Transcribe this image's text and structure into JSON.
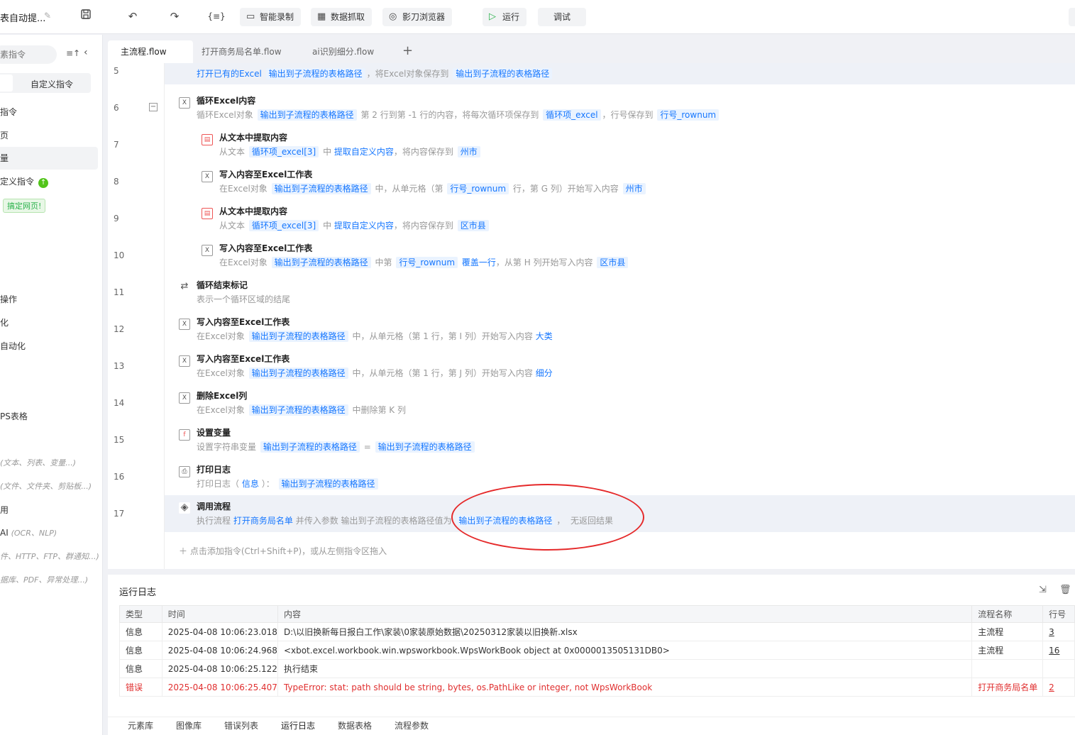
{
  "app": {
    "title": "表自动提...",
    "edit_icon": "pencil-icon"
  },
  "toolbar": {
    "save_icon": "save-icon",
    "undo_icon": "undo-icon",
    "redo_icon": "redo-icon",
    "format_label": "{≡}",
    "smart_record": "智能录制",
    "data_capture": "数据抓取",
    "browser": "影刀浏览器",
    "run": "运行",
    "debug": "调试"
  },
  "sidebar": {
    "search_placeholder": "素指令",
    "custom_tab": "自定义指令",
    "items": [
      {
        "label": "指令"
      },
      {
        "label": "页"
      },
      {
        "label": "量"
      },
      {
        "label": "定义指令"
      },
      {
        "label": "操作"
      },
      {
        "label": "化"
      },
      {
        "label": "自动化"
      },
      {
        "label": "PS表格"
      },
      {
        "label": "",
        "hint": "(文本、列表、变量...)"
      },
      {
        "label": "",
        "hint": "(文件、文件夹、剪贴板...)"
      },
      {
        "label": "用"
      },
      {
        "label": "AI",
        "hint": "(OCR、NLP)"
      },
      {
        "label": "",
        "hint": "件、HTTP、FTP、群通知...)"
      },
      {
        "label": "",
        "hint": "据库、PDF、异常处理...)"
      }
    ],
    "badge": "搞定网页!"
  },
  "tabs": [
    {
      "label": "主流程.flow"
    },
    {
      "label": "打开商务局名单.flow"
    },
    {
      "label": "ai识别细分.flow"
    }
  ],
  "flow": {
    "line_numbers": [
      "5",
      "6",
      "7",
      "8",
      "9",
      "10",
      "11",
      "12",
      "13",
      "14",
      "15",
      "16",
      "17"
    ],
    "rows": [
      {
        "desc_parts": [
          "打开已有的Excel",
          "输出到子流程的表格路径",
          "，将Excel对象保存到",
          "输出到子流程的表格路径"
        ]
      },
      {
        "title": "循环Excel内容",
        "desc": [
          "循环Excel对象",
          "输出到子流程的表格路径",
          "第 2 行到第 -1 行的内容，将每次循环项保存到",
          "循环项_excel",
          "，行号保存到",
          "行号_rownum"
        ]
      },
      {
        "title": "从文本中提取内容",
        "desc": [
          "从文本",
          "循环项_excel[3]",
          "中",
          "提取自定义内容",
          "，将内容保存到",
          "州市"
        ]
      },
      {
        "title": "写入内容至Excel工作表",
        "desc": [
          "在Excel对象",
          "输出到子流程的表格路径",
          "中，从单元格（第",
          "行号_rownum",
          "行，第 G 列）开始写入内容",
          "州市"
        ]
      },
      {
        "title": "从文本中提取内容",
        "desc": [
          "从文本",
          "循环项_excel[3]",
          "中",
          "提取自定义内容",
          "，将内容保存到",
          "区市县"
        ]
      },
      {
        "title": "写入内容至Excel工作表",
        "desc": [
          "在Excel对象",
          "输出到子流程的表格路径",
          "中第",
          "行号_rownum",
          "覆盖一行",
          "，从第 H 列开始写入内容",
          "区市县"
        ]
      },
      {
        "title": "循环结束标记",
        "desc": [
          "表示一个循环区域的结尾"
        ]
      },
      {
        "title": "写入内容至Excel工作表",
        "desc": [
          "在Excel对象",
          "输出到子流程的表格路径",
          "中，从单元格（第 1 行，第 I 列）开始写入内容",
          "大类"
        ]
      },
      {
        "title": "写入内容至Excel工作表",
        "desc": [
          "在Excel对象",
          "输出到子流程的表格路径",
          "中，从单元格（第 1 行，第 J 列）开始写入内容",
          "细分"
        ]
      },
      {
        "title": "删除Excel列",
        "desc": [
          "在Excel对象",
          "输出到子流程的表格路径",
          "中删除第 K 列"
        ]
      },
      {
        "title": "设置变量",
        "desc": [
          "设置字符串变量",
          "输出到子流程的表格路径",
          "=",
          "输出到子流程的表格路径"
        ]
      },
      {
        "title": "打印日志",
        "desc": [
          "打印日志（",
          "信息",
          "）：",
          "输出到子流程的表格路径"
        ]
      },
      {
        "title": "调用流程",
        "desc": [
          "执行流程",
          "打开商务局名单",
          "并传入参数 输出到子流程的表格路径值为",
          "输出到子流程的表格路径",
          "，",
          "无返回结果"
        ]
      }
    ],
    "add_hint": "点击添加指令(Ctrl+Shift+P)，或从左侧指令区拖入"
  },
  "log": {
    "title": "运行日志",
    "columns": [
      "类型",
      "时间",
      "内容",
      "流程名称",
      "行号"
    ],
    "rows": [
      {
        "type": "信息",
        "time": "2025-04-08 10:06:23.018",
        "content": "D:\\以旧换新每日报白工作\\家装\\0家装原始数据\\20250312家装以旧换新.xlsx",
        "flow": "主流程",
        "line": "3"
      },
      {
        "type": "信息",
        "time": "2025-04-08 10:06:24.968",
        "content": "<xbot.excel.workbook.win.wpsworkbook.WpsWorkBook object at 0x0000013505131DB0>",
        "flow": "主流程",
        "line": "16"
      },
      {
        "type": "信息",
        "time": "2025-04-08 10:06:25.122",
        "content": "执行结束",
        "flow": "",
        "line": ""
      },
      {
        "type": "错误",
        "time": "2025-04-08 10:06:25.407",
        "content": "TypeError: stat: path should be string, bytes, os.PathLike or integer, not WpsWorkBook",
        "flow": "打开商务局名单",
        "line": "2"
      }
    ],
    "bottom_tabs": [
      "元素库",
      "图像库",
      "错误列表",
      "运行日志",
      "数据表格",
      "流程参数"
    ]
  },
  "colors": {
    "accent": "#1677ff",
    "error": "#e02f2f",
    "run_green": "#2bb24c",
    "annotation_red": "#e5292a"
  }
}
